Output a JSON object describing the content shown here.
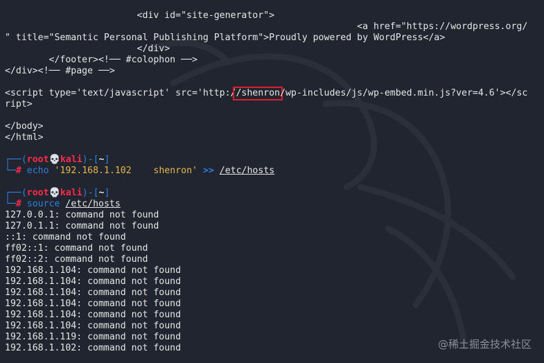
{
  "html_lines": {
    "l1": "                        <div id=\"site-generator\">",
    "l2": "                                                                <a href=\"https://wordpress.org/",
    "l3": "\" title=\"Semantic Personal Publishing Platform\">Proudly powered by WordPress</a>",
    "l4": "                        </div>",
    "l5": "        </footer><!── #colophon ──>",
    "l6": "</div><!── #page ──>",
    "l7_pre": "<script type='text/javascript' src='http:/",
    "l7_mid": "/shenron",
    "l7_post": "/wp-includes/js/wp-embed.min.js?ver=4.6'></sc",
    "l8": "ript>",
    "l9": "</body>",
    "l10": "</html>"
  },
  "prompt": {
    "user": "root",
    "skull": "💀",
    "host": "kali",
    "dir": "~",
    "hash": "#"
  },
  "cmd1": {
    "command": "echo",
    "string": "'192.168.1.102    shenron'",
    "operator": ">>",
    "target": "/etc/hosts"
  },
  "cmd2": {
    "command": "source",
    "target": "/etc/hosts"
  },
  "output": [
    "127.0.0.1: command not found",
    "127.0.1.1: command not found",
    "::1: command not found",
    "ff02::1: command not found",
    "ff02::2: command not found",
    "192.168.1.104: command not found",
    "192.168.1.104: command not found",
    "192.168.1.104: command not found",
    "192.168.1.104: command not found",
    "192.168.1.104: command not found",
    "192.168.1.104: command not found",
    "192.168.1.119: command not found",
    "192.168.1.102: command not found"
  ],
  "watermark": "@稀土掘金技术社区",
  "colors": {
    "background": "#21252f",
    "prompt_red": "#ff2a4a",
    "prompt_blue": "#2f7fe0",
    "string_yellow": "#e8b84d",
    "highlight_box": "#e11d2a"
  }
}
